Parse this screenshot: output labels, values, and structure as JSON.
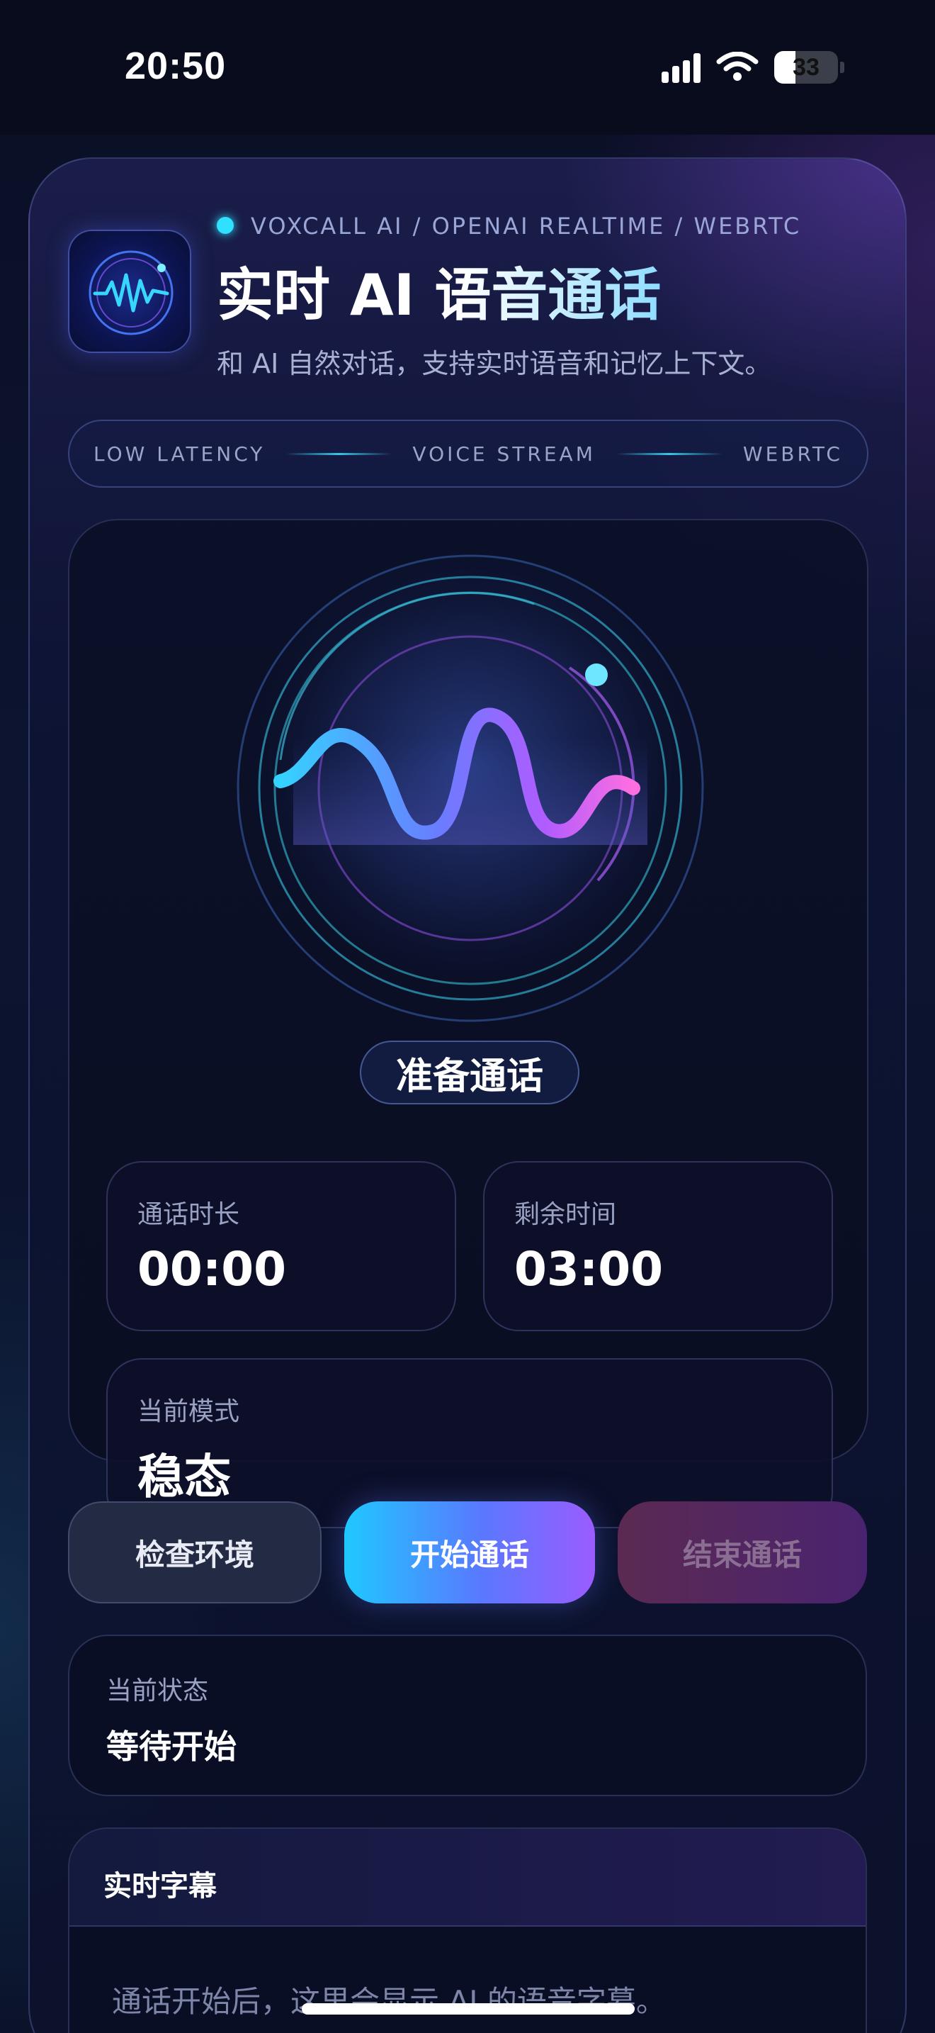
{
  "status_bar": {
    "time": "20:50",
    "battery_level": "33",
    "icons": [
      "cellular-signal-icon",
      "wifi-icon",
      "battery-icon"
    ]
  },
  "header": {
    "app_icon": "waveform-app-icon",
    "tagline": "VOXCALL AI / OPENAI REALTIME / WEBRTC",
    "title": "实时 AI 语音通话",
    "subtitle": "和 AI 自然对话，支持实时语音和记忆上下文。"
  },
  "features": [
    "LOW LATENCY",
    "VOICE STREAM",
    "WEBRTC"
  ],
  "visualizer": {
    "status_label": "准备通话"
  },
  "stats": {
    "duration": {
      "label": "通话时长",
      "value": "00:00"
    },
    "remaining": {
      "label": "剩余时间",
      "value": "03:00"
    },
    "mode": {
      "label": "当前模式",
      "value": "稳态"
    }
  },
  "actions": {
    "check": "检查环境",
    "start": "开始通话",
    "end": "结束通话"
  },
  "status": {
    "label": "当前状态",
    "value": "等待开始"
  },
  "captions": {
    "title": "实时字幕",
    "placeholder": "通话开始后，这里会显示 AI 的语音字幕。"
  },
  "colors": {
    "accent_cyan": "#2fe1ff",
    "accent_purple": "#9b5cff",
    "accent_pink": "#e46ff0",
    "background": "#0a0f24"
  }
}
